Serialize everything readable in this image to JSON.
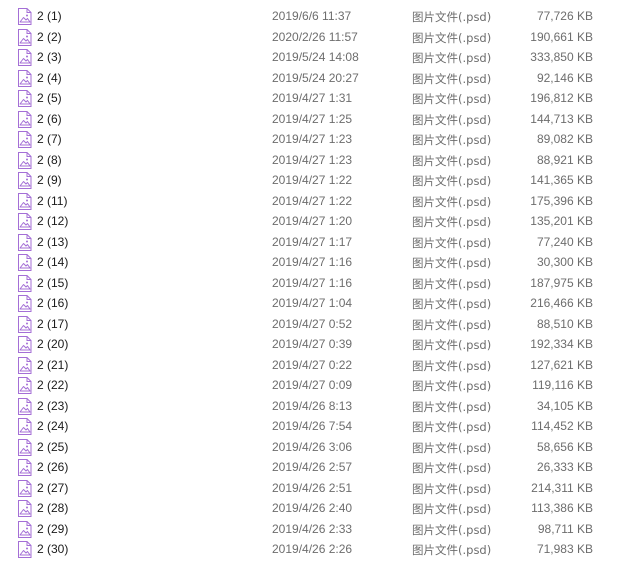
{
  "files": [
    {
      "name": "2 (1)",
      "date": "2019/6/6 11:37",
      "type": "图片文件(.psd)",
      "size": "77,726 KB"
    },
    {
      "name": "2 (2)",
      "date": "2020/2/26 11:57",
      "type": "图片文件(.psd)",
      "size": "190,661 KB"
    },
    {
      "name": "2 (3)",
      "date": "2019/5/24 14:08",
      "type": "图片文件(.psd)",
      "size": "333,850 KB"
    },
    {
      "name": "2 (4)",
      "date": "2019/5/24 20:27",
      "type": "图片文件(.psd)",
      "size": "92,146 KB"
    },
    {
      "name": "2 (5)",
      "date": "2019/4/27 1:31",
      "type": "图片文件(.psd)",
      "size": "196,812 KB"
    },
    {
      "name": "2 (6)",
      "date": "2019/4/27 1:25",
      "type": "图片文件(.psd)",
      "size": "144,713 KB"
    },
    {
      "name": "2 (7)",
      "date": "2019/4/27 1:23",
      "type": "图片文件(.psd)",
      "size": "89,082 KB"
    },
    {
      "name": "2 (8)",
      "date": "2019/4/27 1:23",
      "type": "图片文件(.psd)",
      "size": "88,921 KB"
    },
    {
      "name": "2 (9)",
      "date": "2019/4/27 1:22",
      "type": "图片文件(.psd)",
      "size": "141,365 KB"
    },
    {
      "name": "2 (11)",
      "date": "2019/4/27 1:22",
      "type": "图片文件(.psd)",
      "size": "175,396 KB"
    },
    {
      "name": "2 (12)",
      "date": "2019/4/27 1:20",
      "type": "图片文件(.psd)",
      "size": "135,201 KB"
    },
    {
      "name": "2 (13)",
      "date": "2019/4/27 1:17",
      "type": "图片文件(.psd)",
      "size": "77,240 KB"
    },
    {
      "name": "2 (14)",
      "date": "2019/4/27 1:16",
      "type": "图片文件(.psd)",
      "size": "30,300 KB"
    },
    {
      "name": "2 (15)",
      "date": "2019/4/27 1:16",
      "type": "图片文件(.psd)",
      "size": "187,975 KB"
    },
    {
      "name": "2 (16)",
      "date": "2019/4/27 1:04",
      "type": "图片文件(.psd)",
      "size": "216,466 KB"
    },
    {
      "name": "2 (17)",
      "date": "2019/4/27 0:52",
      "type": "图片文件(.psd)",
      "size": "88,510 KB"
    },
    {
      "name": "2 (20)",
      "date": "2019/4/27 0:39",
      "type": "图片文件(.psd)",
      "size": "192,334 KB"
    },
    {
      "name": "2 (21)",
      "date": "2019/4/27 0:22",
      "type": "图片文件(.psd)",
      "size": "127,621 KB"
    },
    {
      "name": "2 (22)",
      "date": "2019/4/27 0:09",
      "type": "图片文件(.psd)",
      "size": "119,116 KB"
    },
    {
      "name": "2 (23)",
      "date": "2019/4/26 8:13",
      "type": "图片文件(.psd)",
      "size": "34,105 KB"
    },
    {
      "name": "2 (24)",
      "date": "2019/4/26 7:54",
      "type": "图片文件(.psd)",
      "size": "114,452 KB"
    },
    {
      "name": "2 (25)",
      "date": "2019/4/26 3:06",
      "type": "图片文件(.psd)",
      "size": "58,656 KB"
    },
    {
      "name": "2 (26)",
      "date": "2019/4/26 2:57",
      "type": "图片文件(.psd)",
      "size": "26,333 KB"
    },
    {
      "name": "2 (27)",
      "date": "2019/4/26 2:51",
      "type": "图片文件(.psd)",
      "size": "214,311 KB"
    },
    {
      "name": "2 (28)",
      "date": "2019/4/26 2:40",
      "type": "图片文件(.psd)",
      "size": "113,386 KB"
    },
    {
      "name": "2 (29)",
      "date": "2019/4/26 2:33",
      "type": "图片文件(.psd)",
      "size": "98,711 KB"
    },
    {
      "name": "2 (30)",
      "date": "2019/4/26 2:26",
      "type": "图片文件(.psd)",
      "size": "71,983 KB"
    }
  ],
  "icon": {
    "name": "image-file-icon",
    "color": "#9b59d0"
  }
}
